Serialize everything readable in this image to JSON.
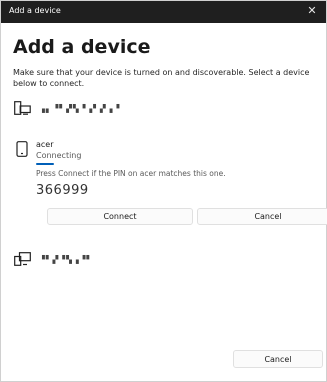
{
  "window": {
    "title": "Add a device",
    "close_glyph": "✕"
  },
  "heading": "Add a device",
  "description": "Make sure that your device is turned on and discoverable. Select a device below to connect.",
  "devices": [
    {
      "icon": "monitor-device-icon",
      "name": "▗▖▝▘▞▚▝▗▘▞▗▝",
      "obscured": true
    },
    {
      "icon": "phone-icon",
      "name": "acer",
      "status": "Connecting",
      "progress_fraction": 0.2,
      "pin_hint": "Press Connect if the PIN on acer matches this one.",
      "pin": "366999",
      "connect_label": "Connect",
      "cancel_label": "Cancel"
    },
    {
      "icon": "pc-device-icon",
      "name": "▝▘▞▝▚▗▝▘",
      "obscured": true
    }
  ],
  "footer": {
    "cancel_label": "Cancel"
  },
  "colors": {
    "titlebar": "#1f1f1f",
    "accent": "#005fb8",
    "background": "#ffffff"
  }
}
